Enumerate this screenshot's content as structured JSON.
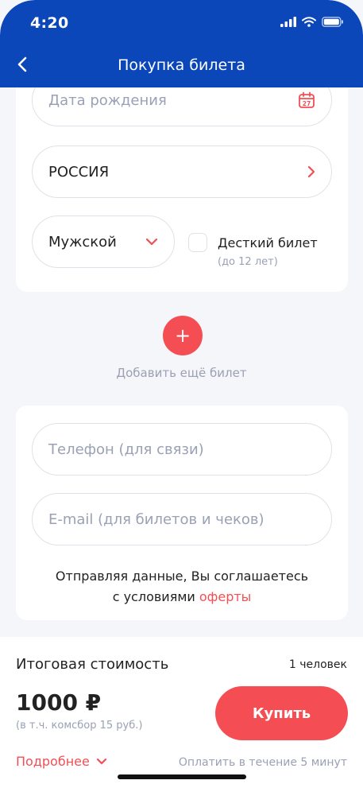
{
  "status_bar": {
    "time": "4:20"
  },
  "header": {
    "title": "Покупка билета"
  },
  "form": {
    "birth_date_placeholder": "Дата рождения",
    "calendar_day": "27",
    "country_value": "РОССИЯ",
    "gender_value": "Мужской",
    "child_ticket_label": "Десткий билет",
    "child_ticket_hint": "(до 12 лет)"
  },
  "add_ticket": {
    "icon": "+",
    "label": "Добавить ещё билет"
  },
  "contacts": {
    "phone_placeholder": "Телефон (для связи)",
    "email_placeholder": "E-mail (для билетов и чеков)",
    "consent_text": "Отправляя данные, Вы соглашаетесь",
    "consent_prefix": "с условиями ",
    "consent_link": "оферты"
  },
  "footer": {
    "total_label": "Итоговая стоимость",
    "persons": "1 человек",
    "price": "1000 ₽",
    "price_note": "(в т.ч. комсбор 15 руб.)",
    "buy_label": "Купить",
    "details_label": "Подробнее",
    "pay_within": "Оплатить в течение 5 минут"
  },
  "colors": {
    "brand_blue": "#0b47b8",
    "accent_red": "#f44e54",
    "muted": "#9aa1b4"
  }
}
